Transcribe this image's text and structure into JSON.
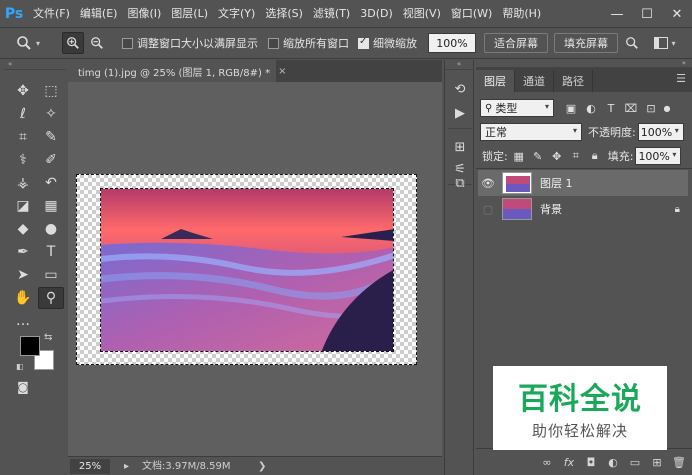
{
  "app": {
    "logo": "Ps",
    "menu": [
      "文件(F)",
      "编辑(E)",
      "图像(I)",
      "图层(L)",
      "文字(Y)",
      "选择(S)",
      "滤镜(T)",
      "3D(D)",
      "视图(V)",
      "窗口(W)",
      "帮助(H)"
    ],
    "window_controls": {
      "minimize": "—",
      "maximize": "☐",
      "close": "✕"
    }
  },
  "options": {
    "tool_icon": "zoom-icon",
    "checkbox_resize": {
      "label": "调整窗口大小以满屏显示",
      "checked": false
    },
    "checkbox_zoom_all": {
      "label": "缩放所有窗口",
      "checked": false
    },
    "checkbox_scrubby": {
      "label": "细微缩放",
      "checked": true
    },
    "zoom_value": "100%",
    "fit_screen": "适合屏幕",
    "fill_screen": "填充屏幕"
  },
  "document": {
    "tab_title": "timg (1).jpg @ 25% (图层 1, RGB/8#) *",
    "tab_close": "×",
    "zoom": "25%",
    "doc_info": "文档:3.97M/8.59M"
  },
  "toolbar": {
    "tools": [
      {
        "name": "move-tool",
        "glyph": "✥"
      },
      {
        "name": "marquee-tool",
        "glyph": "⬚"
      },
      {
        "name": "lasso-tool",
        "glyph": "ℓ"
      },
      {
        "name": "magic-wand-tool",
        "glyph": "✧"
      },
      {
        "name": "crop-tool",
        "glyph": "⌗"
      },
      {
        "name": "eyedropper-tool",
        "glyph": "✎"
      },
      {
        "name": "healing-brush-tool",
        "glyph": "⚕"
      },
      {
        "name": "brush-tool",
        "glyph": "✐"
      },
      {
        "name": "clone-stamp-tool",
        "glyph": "⚶"
      },
      {
        "name": "history-brush-tool",
        "glyph": "↶"
      },
      {
        "name": "eraser-tool",
        "glyph": "◪"
      },
      {
        "name": "gradient-tool",
        "glyph": "▦"
      },
      {
        "name": "blur-tool",
        "glyph": "◆"
      },
      {
        "name": "dodge-tool",
        "glyph": "●"
      },
      {
        "name": "pen-tool",
        "glyph": "✒"
      },
      {
        "name": "type-tool",
        "glyph": "T"
      },
      {
        "name": "path-selection-tool",
        "glyph": "➤"
      },
      {
        "name": "rectangle-tool",
        "glyph": "▭"
      },
      {
        "name": "hand-tool",
        "glyph": "✋"
      },
      {
        "name": "zoom-tool",
        "glyph": "⚲"
      },
      {
        "name": "more-tools",
        "glyph": "…"
      }
    ],
    "foreground_color": "#000000",
    "background_color": "#ffffff"
  },
  "icon_strip": {
    "buttons": [
      "history-icon",
      "play-icon",
      "properties-icon",
      "brush-settings-icon",
      "clone-source-icon"
    ]
  },
  "layers_panel": {
    "tabs": [
      "图层",
      "通道",
      "路径"
    ],
    "active_tab": 0,
    "filter_kind": "类型",
    "blend_mode": "正常",
    "opacity_label": "不透明度:",
    "opacity_value": "100%",
    "lock_label": "锁定:",
    "fill_label": "填充:",
    "fill_value": "100%",
    "layers": [
      {
        "name": "图层 1",
        "visible": true,
        "selected": true,
        "locked": false
      },
      {
        "name": "背景",
        "visible": false,
        "selected": false,
        "locked": true
      }
    ],
    "bottom_icons": [
      "link-icon",
      "fx-icon",
      "mask-icon",
      "adjustment-icon",
      "group-icon",
      "new-layer-icon",
      "delete-icon"
    ],
    "fx_label": "fx"
  },
  "watermark": {
    "title": "百科全说",
    "subtitle": "助你轻松解决"
  }
}
